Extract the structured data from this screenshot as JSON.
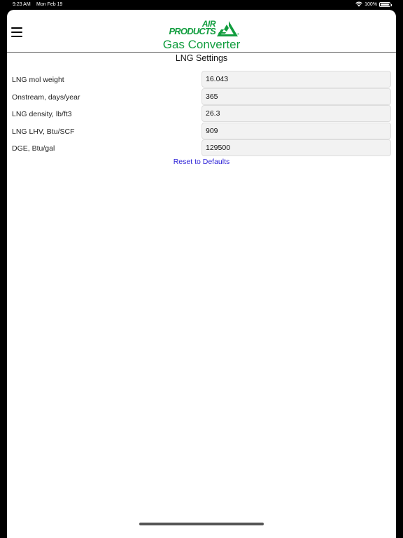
{
  "status_bar": {
    "time": "9:23 AM",
    "date": "Mon Feb 19",
    "battery": "100%",
    "battery_level": 1.0,
    "wifi_icon": "wifi-icon"
  },
  "header": {
    "menu_icon": "hamburger-menu-icon",
    "logo": {
      "line1": "AIR",
      "line2": "PRODUCTS",
      "reg": "®",
      "color": "#119d3e"
    },
    "app_title": "Gas Converter"
  },
  "page": {
    "section_title": "LNG Settings",
    "fields": [
      {
        "label": "LNG mol weight",
        "value": "16.043"
      },
      {
        "label": "Onstream, days/year",
        "value": "365"
      },
      {
        "label": "LNG density, lb/ft3",
        "value": "26.3"
      },
      {
        "label": "LNG LHV, Btu/SCF",
        "value": "909"
      },
      {
        "label": "DGE, Btu/gal",
        "value": "129500"
      }
    ],
    "reset_label": "Reset to Defaults"
  },
  "colors": {
    "brand_green": "#119d3e",
    "link_blue": "#2a1fd6",
    "input_bg": "#f2f2f2"
  }
}
